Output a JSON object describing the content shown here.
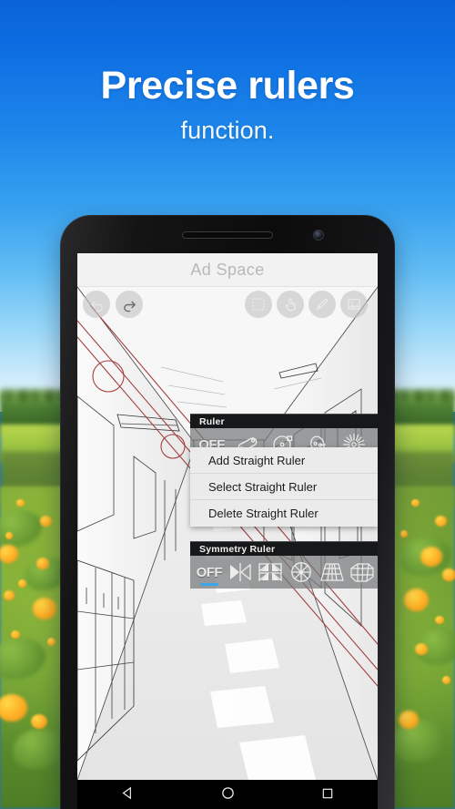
{
  "headline": {
    "line1": "Precise rulers",
    "line2": "function."
  },
  "colors": {
    "sky_top": "#0a62d8",
    "sky_bottom": "#e8f4fa",
    "field": "#5f8c2f",
    "flower": "#ffb52a",
    "accent_blue": "#3ba7e8",
    "panel_header_bg": "#17181a",
    "panel_row_bg": "#76787a",
    "menu_bg": "#ebebeb",
    "guide_red": "#a33f3f",
    "phone_body": "#141415",
    "navbar_bg": "#000000"
  },
  "phone": {
    "speaker": "speaker-grille",
    "front_camera": "front-camera"
  },
  "app": {
    "ad_banner": {
      "label": "Ad Space"
    },
    "toolbar": {
      "left": [
        {
          "name": "undo-button",
          "icon": "undo-icon"
        },
        {
          "name": "redo-button",
          "icon": "redo-icon"
        }
      ],
      "right": [
        {
          "name": "selection-tool-button",
          "icon": "dashed-selection-icon"
        },
        {
          "name": "hand-tool-button",
          "icon": "hand-tap-icon"
        },
        {
          "name": "pencil-tool-button",
          "icon": "pencil-icon"
        },
        {
          "name": "image-tool-button",
          "icon": "image-icon"
        }
      ]
    },
    "ruler_panel": {
      "title": "Ruler",
      "options": [
        {
          "label": "OFF",
          "icon": "off-icon",
          "active": false
        },
        {
          "label": "",
          "icon": "straight-ruler-icon",
          "active": true
        },
        {
          "label": "",
          "icon": "circle-ruler-icon",
          "active": false
        },
        {
          "label": "",
          "icon": "ellipse-ruler-icon",
          "active": false
        },
        {
          "label": "",
          "icon": "radial-burst-ruler-icon",
          "active": false
        }
      ],
      "menu_items": [
        "Add Straight Ruler",
        "Select Straight Ruler",
        "Delete Straight Ruler"
      ]
    },
    "symmetry_panel": {
      "title": "Symmetry Ruler",
      "options": [
        {
          "label": "OFF",
          "icon": "off-icon",
          "active": true
        },
        {
          "label": "",
          "icon": "mirror-symmetry-icon",
          "active": false
        },
        {
          "label": "",
          "icon": "quad-mirror-symmetry-icon",
          "active": false
        },
        {
          "label": "",
          "icon": "radial-wheel-symmetry-icon",
          "active": false
        },
        {
          "label": "",
          "icon": "perspective-grid-icon",
          "active": false
        },
        {
          "label": "",
          "icon": "box-grid-icon",
          "active": false
        }
      ]
    },
    "canvas": {
      "artwork": "school-hallway-perspective-drawing",
      "guides": "red-straight-ruler-guides"
    },
    "navbar": [
      {
        "name": "android-back-button",
        "icon": "triangle-back-icon"
      },
      {
        "name": "android-home-button",
        "icon": "circle-home-icon"
      },
      {
        "name": "android-recents-button",
        "icon": "square-recents-icon"
      }
    ]
  }
}
